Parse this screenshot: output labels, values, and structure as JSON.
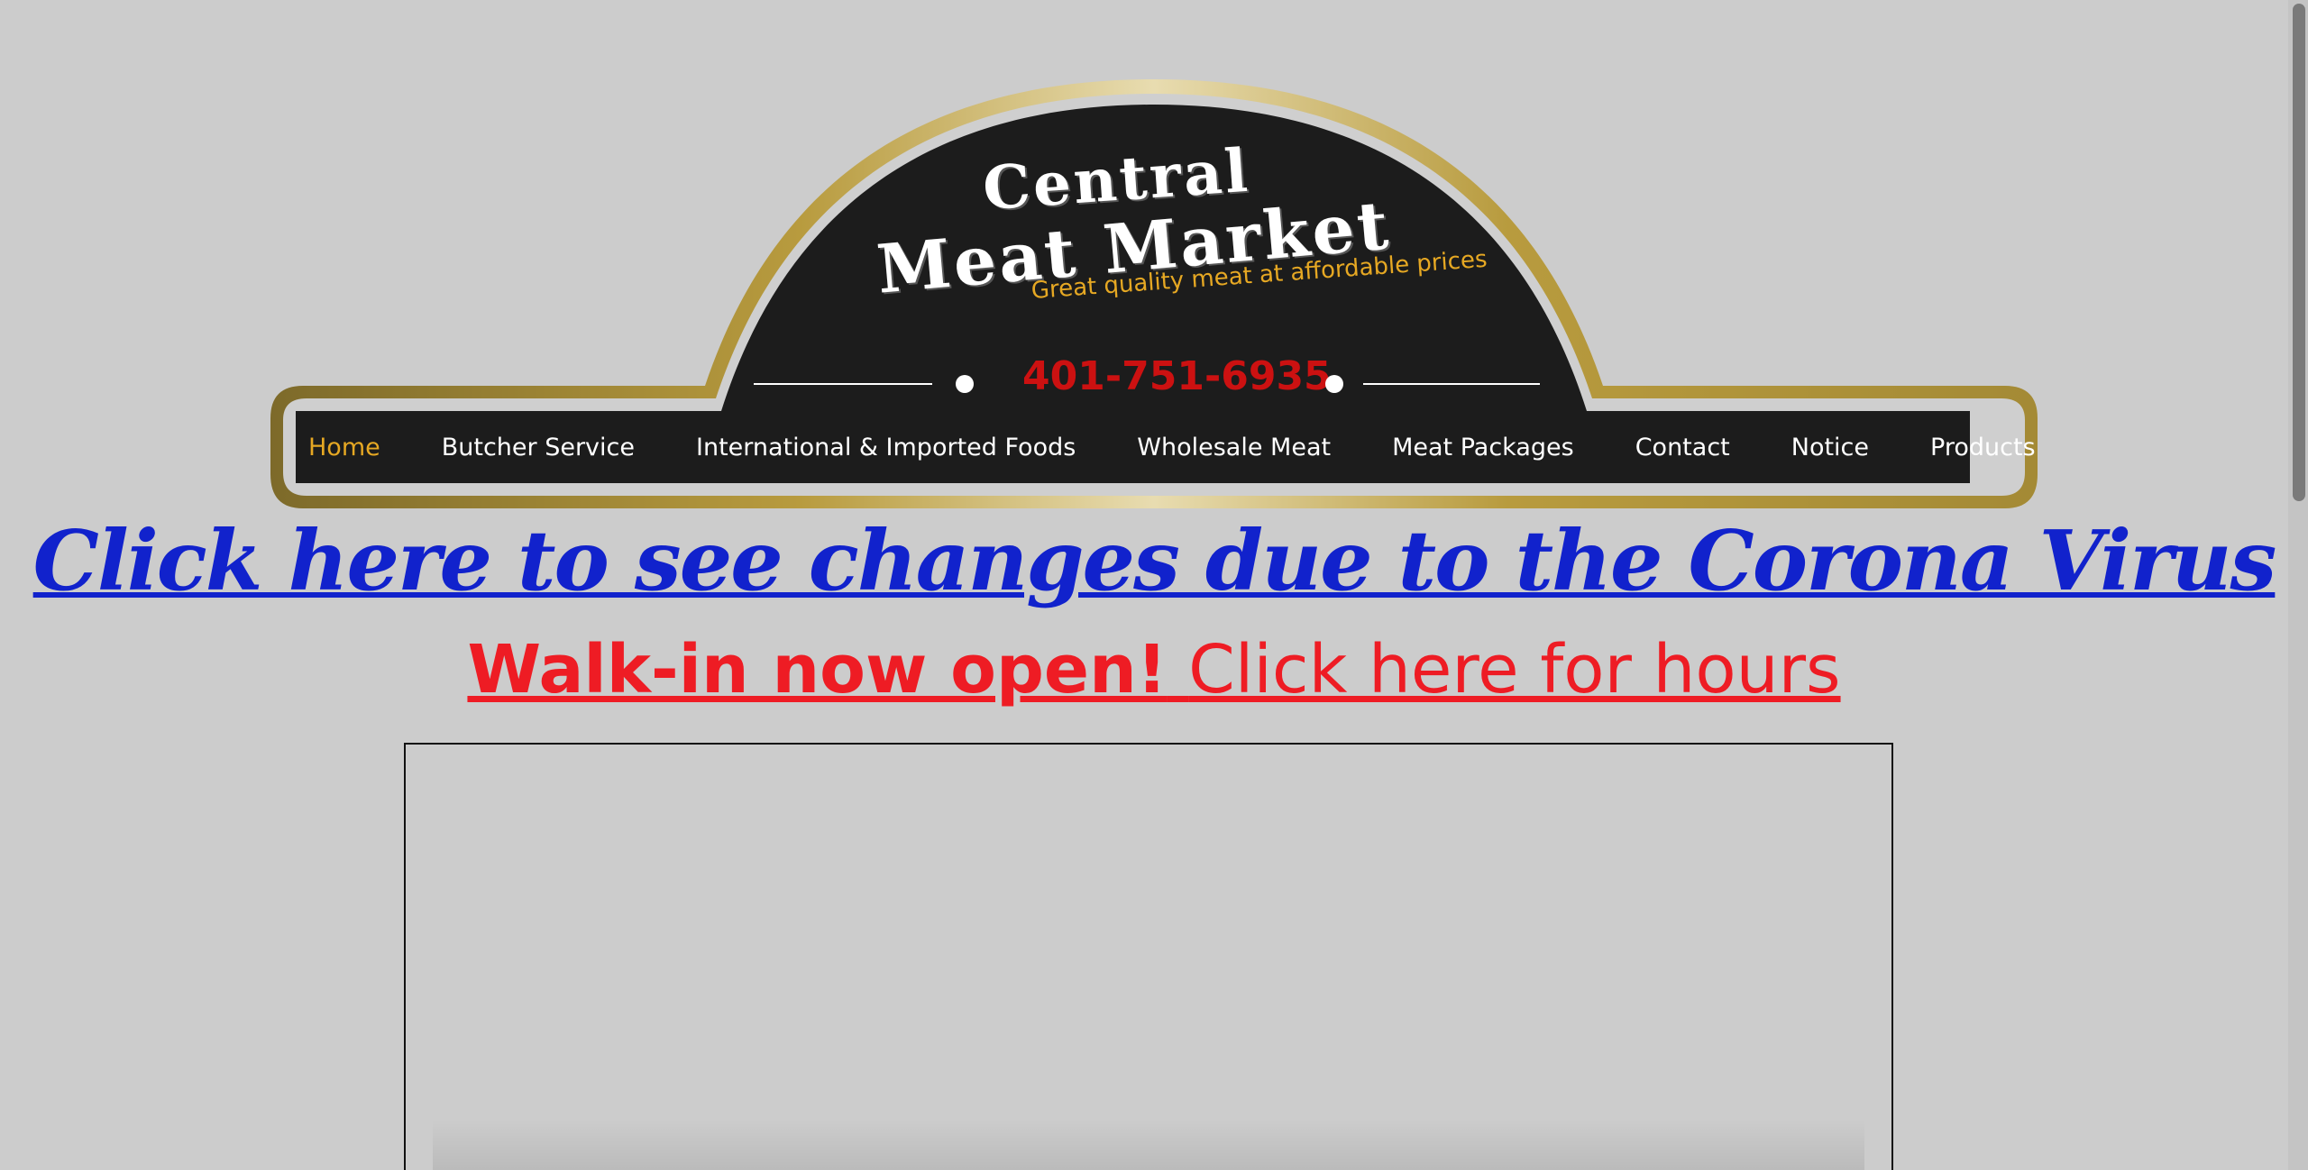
{
  "header": {
    "logo_line1": "Central",
    "logo_line2": "Meat Market",
    "tagline": "Great quality meat at affordable prices",
    "phone": "401-751-6935"
  },
  "nav": {
    "items": [
      {
        "label": "Home",
        "active": true
      },
      {
        "label": "Butcher Service",
        "active": false
      },
      {
        "label": "International & Imported Foods",
        "active": false
      },
      {
        "label": "Wholesale Meat",
        "active": false
      },
      {
        "label": "Meat Packages",
        "active": false
      },
      {
        "label": "Contact",
        "active": false
      },
      {
        "label": "Notice",
        "active": false
      },
      {
        "label": "Products",
        "active": false
      }
    ]
  },
  "announcements": {
    "corona_link": "Click here to see changes due to the Corona Virus",
    "walkin_bold": "Walk-in now open!",
    "walkin_link": "Click here for hours"
  },
  "colors": {
    "background": "#cccccc",
    "badge_dark": "#1c1c1c",
    "gold": "#b89b3e",
    "accent_orange": "#e6a823",
    "phone_red": "#cc1111",
    "link_blue": "#1122cc",
    "walkin_red": "#ee1c24"
  }
}
